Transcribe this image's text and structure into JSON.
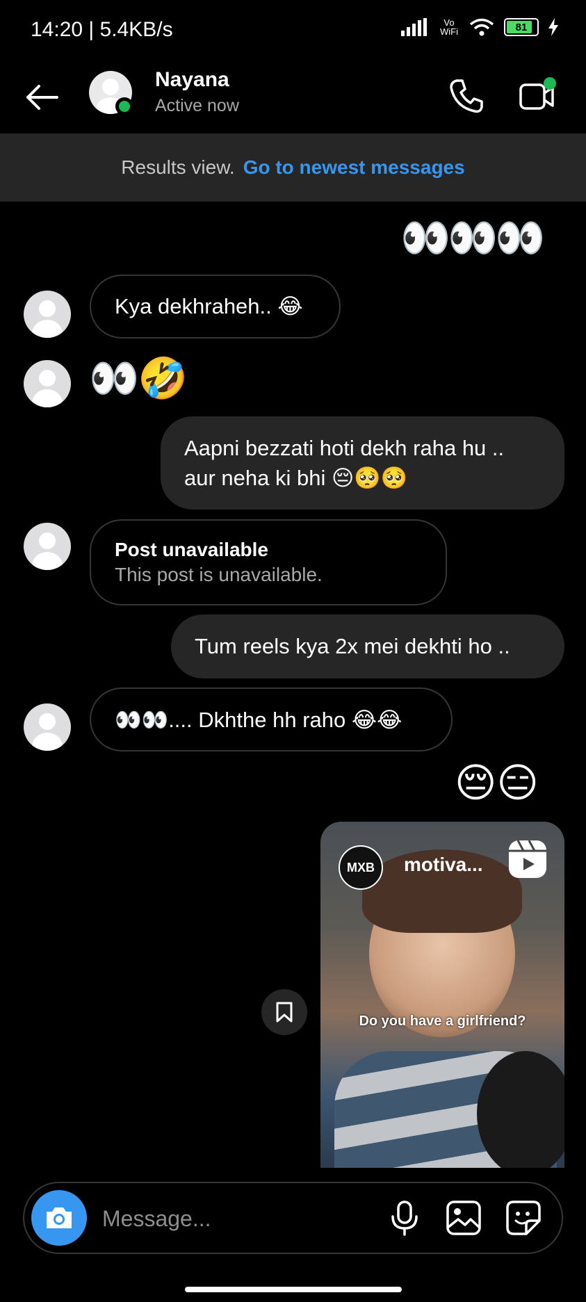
{
  "status_bar": {
    "time": "14:20 | 5.4KB/s",
    "battery": "81",
    "network": "Vo WiFi"
  },
  "header": {
    "name": "Nayana",
    "status": "Active now"
  },
  "banner": {
    "label": "Results view.",
    "link": "Go to newest messages"
  },
  "messages": [
    {
      "side": "out",
      "type": "emoji",
      "text": "👀👀👀"
    },
    {
      "side": "in",
      "type": "text",
      "text": "Kya dekhraheh.. 😂"
    },
    {
      "side": "in",
      "type": "emoji",
      "text": "👀🤣"
    },
    {
      "side": "out",
      "type": "text",
      "line1": "Aapni bezzati hoti dekh raha hu ..",
      "line2": "aur neha ki bhi 😔🥺🥺"
    },
    {
      "side": "in",
      "type": "post",
      "title": "Post unavailable",
      "body": "This post is unavailable."
    },
    {
      "side": "out",
      "type": "text",
      "text": "Tum reels kya 2x mei dekhti ho .."
    },
    {
      "side": "in",
      "type": "text",
      "text": "👀👀.... Dkhthe hh raho 😂😂"
    },
    {
      "side": "out",
      "type": "emoji",
      "text": "😔😑"
    }
  ],
  "reel": {
    "logo": "MXB",
    "username": "motiva...",
    "caption": "Do you have a girlfriend?"
  },
  "composer": {
    "placeholder": "Message..."
  },
  "colors": {
    "accent": "#3797f0",
    "online": "#1db954",
    "bubble": "#262626",
    "banner": "#262626"
  },
  "icons": [
    "back-arrow-icon",
    "phone-icon",
    "video-call-icon",
    "camera-icon",
    "microphone-icon",
    "gallery-icon",
    "sticker-icon",
    "bookmark-icon",
    "reels-icon"
  ]
}
